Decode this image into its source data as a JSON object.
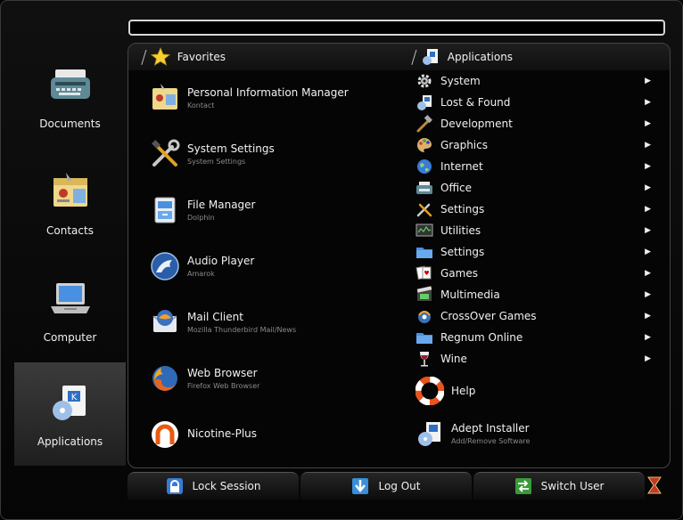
{
  "search": {
    "value": ""
  },
  "sidebar": {
    "items": [
      {
        "label": "Documents",
        "icon": "typewriter-icon"
      },
      {
        "label": "Contacts",
        "icon": "address-book-icon"
      },
      {
        "label": "Computer",
        "icon": "laptop-icon"
      },
      {
        "label": "Applications",
        "icon": "applications-icon",
        "active": true
      }
    ]
  },
  "favorites": {
    "title": "Favorites",
    "items": [
      {
        "name": "Personal Information Manager",
        "sub": "Kontact"
      },
      {
        "name": "System Settings",
        "sub": "System Settings"
      },
      {
        "name": "File Manager",
        "sub": "Dolphin"
      },
      {
        "name": "Audio Player",
        "sub": "Amarok"
      },
      {
        "name": "Mail Client",
        "sub": "Mozilla Thunderbird Mail/News"
      },
      {
        "name": "Web Browser",
        "sub": "Firefox Web Browser"
      },
      {
        "name": "Nicotine-Plus",
        "sub": ""
      }
    ]
  },
  "applications": {
    "title": "Applications",
    "items": [
      {
        "label": "System",
        "icon": "gear-icon"
      },
      {
        "label": "Lost & Found",
        "icon": "kde-package-icon"
      },
      {
        "label": "Development",
        "icon": "hammer-icon"
      },
      {
        "label": "Graphics",
        "icon": "palette-icon"
      },
      {
        "label": "Internet",
        "icon": "globe-icon"
      },
      {
        "label": "Office",
        "icon": "typewriter-icon"
      },
      {
        "label": "Settings",
        "icon": "tools-icon"
      },
      {
        "label": "Utilities",
        "icon": "monitor-icon"
      },
      {
        "label": "Settings",
        "icon": "folder-icon"
      },
      {
        "label": "Games",
        "icon": "cards-icon"
      },
      {
        "label": "Multimedia",
        "icon": "film-icon"
      },
      {
        "label": "CrossOver Games",
        "icon": "crossover-icon"
      },
      {
        "label": "Regnum Online",
        "icon": "folder-icon"
      },
      {
        "label": "Wine",
        "icon": "wine-glass-icon"
      }
    ],
    "help": {
      "label": "Help"
    },
    "adept": {
      "name": "Adept Installer",
      "sub": "Add/Remove Software"
    }
  },
  "footer": {
    "lock": "Lock Session",
    "logout": "Log Out",
    "switch": "Switch User"
  },
  "colors": {
    "background": "#000000",
    "highlight": "#333333",
    "accent_blue": "#3a7bd5"
  }
}
